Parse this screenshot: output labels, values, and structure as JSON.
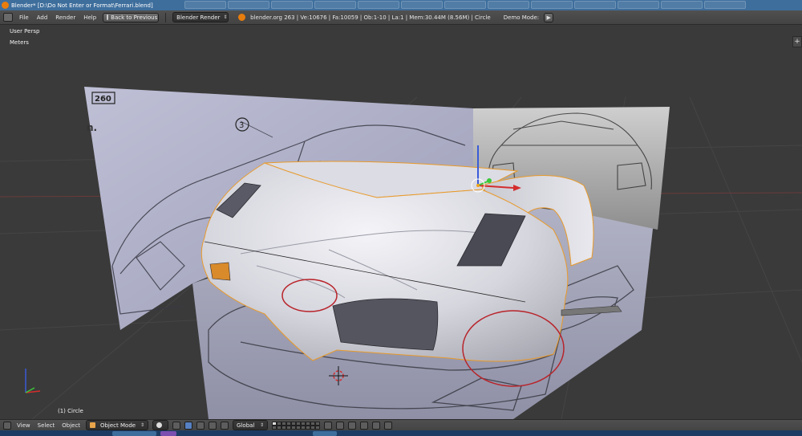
{
  "window": {
    "title": "Blender* [D:\\Do Not Enter or Format\\Ferrari.blend]"
  },
  "menubar": {
    "items": [
      "File",
      "Add",
      "Render",
      "Help"
    ],
    "back_button": "Back to Previous",
    "render_engine": "Blender Render",
    "stats": "blender.org 263 | Ve:10676 | Fa:10059 | Ob:1-10 | La:1 | Mem:30.44M (8.56M) | Circle",
    "demo_mode_label": "Demo Mode:"
  },
  "viewport": {
    "view_label": "User Persp",
    "units_label": "Meters",
    "object_label": "(1) Circle",
    "annotation_color": "#b8242a",
    "selection_color": "#e89a2a"
  },
  "header": {
    "menus": [
      "View",
      "Select",
      "Object"
    ],
    "mode": "Object Mode",
    "orientation": "Global"
  },
  "icons": {
    "blender_logo": "blender-logo-icon",
    "editor_type": "3d-view-icon",
    "viewport_shading": "solid-shading-icon",
    "pivot": "pivot-point-icon",
    "manipulator": "manipulator-icon",
    "snap": "snap-magnet-icon",
    "render_preview": "render-icon",
    "play": "play-icon"
  }
}
